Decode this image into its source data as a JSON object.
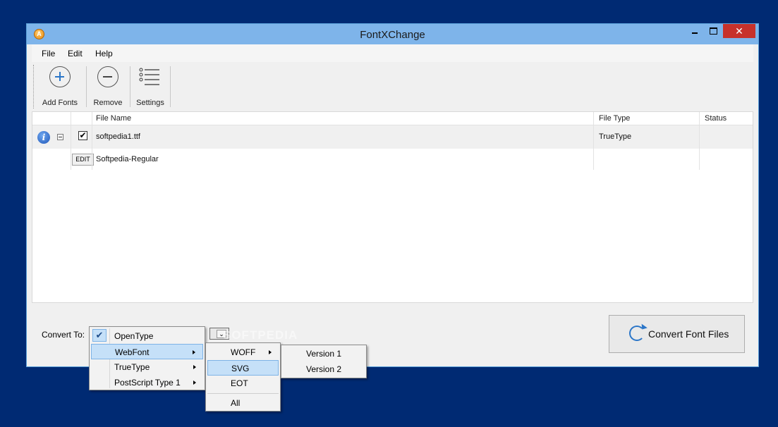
{
  "window": {
    "title": "FontXChange",
    "app_icon_letter": "A",
    "close_glyph": "✕"
  },
  "menubar": {
    "items": [
      {
        "label": "File",
        "mnemonic": "F"
      },
      {
        "label": "Edit",
        "mnemonic": "E"
      },
      {
        "label": "Help",
        "mnemonic": "H"
      }
    ]
  },
  "toolbar": {
    "add_fonts": "Add Fonts",
    "remove": "Remove",
    "settings": "Settings"
  },
  "grid": {
    "columns": [
      "File Name",
      "File Type",
      "Status"
    ],
    "rows": [
      {
        "file_name": "softpedia1.ttf",
        "file_type": "TrueType",
        "status": "",
        "checked": "✔",
        "info_glyph": "i"
      },
      {
        "edit_label": "EDIT",
        "font_name": "Softpedia-Regular"
      }
    ]
  },
  "bottom": {
    "convert_to_label": "Convert To:",
    "convert_button": "Convert Font Files",
    "combo_glyph": "⌄"
  },
  "convert_menu": {
    "items": [
      {
        "label": "OpenType",
        "checked": "✔"
      },
      {
        "label": "WebFont"
      },
      {
        "label": "TrueType"
      },
      {
        "label": "PostScript Type 1"
      }
    ]
  },
  "webfont_menu": {
    "items": [
      {
        "label": "WOFF"
      },
      {
        "label": "SVG"
      },
      {
        "label": "EOT"
      },
      {
        "label": "All"
      }
    ]
  },
  "woff_menu": {
    "items": [
      {
        "label": "Version 1"
      },
      {
        "label": "Version 2"
      }
    ]
  },
  "watermark": "SOFTPEDIA",
  "colors": {
    "desktop": "#002a73",
    "titlebar": "#7eb4ea",
    "close_button": "#c7312b",
    "menu_highlight": "#c5e0f8",
    "accent_blue": "#2b76c8"
  }
}
